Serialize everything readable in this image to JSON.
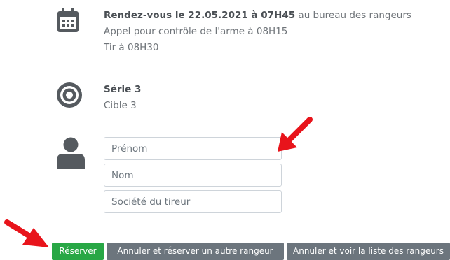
{
  "rdv": {
    "prefix": "Rendez-vous le 22.05.2021 à 07H45",
    "suffix": " au bureau des rangeurs",
    "line2": "Appel pour contrôle de l'arme à 08H15",
    "line3": "Tir à 08H30"
  },
  "serie": {
    "title": "Série 3",
    "cible": "Cible 3"
  },
  "form": {
    "prenom_placeholder": "Prénom",
    "nom_placeholder": "Nom",
    "societe_placeholder": "Société du tireur"
  },
  "actions": {
    "reserver": "Réserver",
    "annuler_autre": "Annuler et réserver un autre rangeur",
    "annuler_liste": "Annuler et voir la liste des rangeurs"
  },
  "colors": {
    "icon": "#555a5f",
    "success": "#28a745",
    "secondary": "#6c757d",
    "arrow": "#e8141b"
  }
}
